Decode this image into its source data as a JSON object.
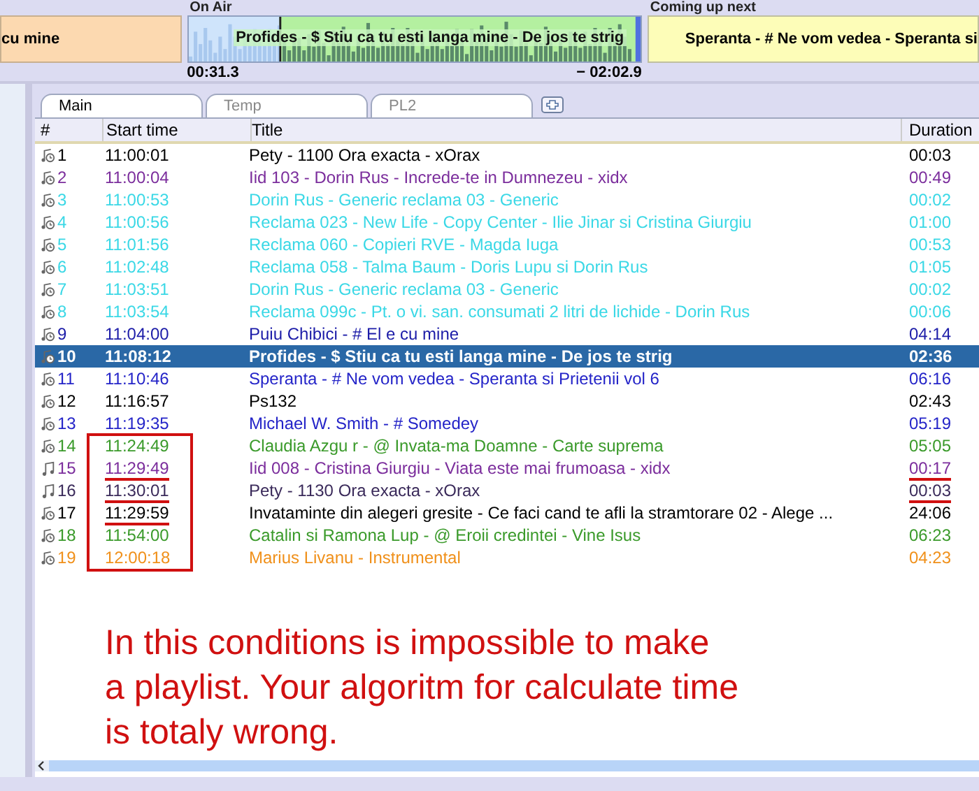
{
  "previous": {
    "title": "cu mine"
  },
  "on_air": {
    "label": "On Air",
    "title": "Profides - $ Stiu ca tu esti langa mine - De jos te strig",
    "elapsed": "00:31.3",
    "remaining": "− 02:02.9",
    "level": 0.2
  },
  "coming_up": {
    "label": "Coming up next",
    "title": "Speranta - # Ne vom vedea - Speranta si"
  },
  "tabs": [
    {
      "label": "Main",
      "selected": true
    },
    {
      "label": "Temp",
      "selected": false
    },
    {
      "label": "PL2",
      "selected": false
    }
  ],
  "columns": [
    "#",
    "Start time",
    "Title",
    "Duration"
  ],
  "rows": [
    {
      "kind": "timed",
      "num": "1",
      "start": "11:00:01",
      "title": "Pety - 1100 Ora exacta - xOrax",
      "duration": "00:03",
      "color": "#000000",
      "selected": false,
      "boxed": false,
      "start_marked": false,
      "duration_marked": false
    },
    {
      "kind": "timed",
      "num": "2",
      "start": "11:00:04",
      "title": "Iid 103 - Dorin Rus - Increde-te in Dumnezeu - xidx",
      "duration": "00:49",
      "color": "#7b2d9c",
      "selected": false,
      "boxed": false,
      "start_marked": false,
      "duration_marked": false
    },
    {
      "kind": "timed",
      "num": "3",
      "start": "11:00:53",
      "title": "Dorin Rus - Generic reclama 03 - Generic",
      "duration": "00:02",
      "color": "#3ad8e6",
      "selected": false,
      "boxed": false,
      "start_marked": false,
      "duration_marked": false
    },
    {
      "kind": "timed",
      "num": "4",
      "start": "11:00:56",
      "title": "Reclama 023 - New Life - Copy Center - Ilie Jinar si Cristina Giurgiu",
      "duration": "01:00",
      "color": "#3ad8e6",
      "selected": false,
      "boxed": false,
      "start_marked": false,
      "duration_marked": false
    },
    {
      "kind": "timed",
      "num": "5",
      "start": "11:01:56",
      "title": "Reclama 060 - Copieri RVE - Magda Iuga",
      "duration": "00:53",
      "color": "#3ad8e6",
      "selected": false,
      "boxed": false,
      "start_marked": false,
      "duration_marked": false
    },
    {
      "kind": "timed",
      "num": "6",
      "start": "11:02:48",
      "title": "Reclama 058 - Talma Baum - Doris Lupu si Dorin Rus",
      "duration": "01:05",
      "color": "#3ad8e6",
      "selected": false,
      "boxed": false,
      "start_marked": false,
      "duration_marked": false
    },
    {
      "kind": "timed",
      "num": "7",
      "start": "11:03:51",
      "title": "Dorin Rus - Generic reclama 03 - Generic",
      "duration": "00:02",
      "color": "#3ad8e6",
      "selected": false,
      "boxed": false,
      "start_marked": false,
      "duration_marked": false
    },
    {
      "kind": "timed",
      "num": "8",
      "start": "11:03:54",
      "title": "Reclama 099c - Pt. o vi. san. consumati 2 litri de lichide - Dorin Rus",
      "duration": "00:06",
      "color": "#3ad8e6",
      "selected": false,
      "boxed": false,
      "start_marked": false,
      "duration_marked": false
    },
    {
      "kind": "timed",
      "num": "9",
      "start": "11:04:00",
      "title": "Puiu Chibici - # El e cu mine",
      "duration": "04:14",
      "color": "#1c1ca8",
      "selected": false,
      "boxed": false,
      "start_marked": false,
      "duration_marked": false
    },
    {
      "kind": "timed",
      "num": "10",
      "start": "11:08:12",
      "title": "Profides - $ Stiu ca tu esti langa mine - De jos te strig",
      "duration": "02:36",
      "selected": true,
      "boxed": false,
      "start_marked": false,
      "duration_marked": false
    },
    {
      "kind": "timed",
      "num": "11",
      "start": "11:10:46",
      "title": "Speranta - # Ne vom vedea - Speranta si Prietenii vol 6",
      "duration": "06:16",
      "color": "#2424c8",
      "selected": false,
      "boxed": false,
      "start_marked": false,
      "duration_marked": false
    },
    {
      "kind": "timed",
      "num": "12",
      "start": "11:16:57",
      "title": "Ps132",
      "duration": "02:43",
      "color": "#000000",
      "selected": false,
      "boxed": false,
      "start_marked": false,
      "duration_marked": false
    },
    {
      "kind": "timed",
      "num": "13",
      "start": "11:19:35",
      "title": "Michael W. Smith - # Somedey",
      "duration": "05:19",
      "color": "#2424c8",
      "selected": false,
      "boxed": false,
      "start_marked": false,
      "duration_marked": false
    },
    {
      "kind": "timed",
      "num": "14",
      "start": "11:24:49",
      "title": "Claudia Azgu r - @ Invata-ma Doamne - Carte suprema",
      "duration": "05:05",
      "color": "#3a9a2a",
      "selected": false,
      "boxed": true,
      "start_marked": false,
      "duration_marked": false
    },
    {
      "kind": "note",
      "num": "15",
      "start": "11:29:49",
      "title": "Iid 008 - Cristina Giurgiu - Viata este mai frumoasa - xidx",
      "duration": "00:17",
      "color": "#7b2d9c",
      "selected": false,
      "boxed": true,
      "start_marked": true,
      "duration_marked": true
    },
    {
      "kind": "note",
      "num": "16",
      "start": "11:30:01",
      "title": "Pety - 1130 Ora exacta - xOrax",
      "duration": "00:03",
      "color": "#3a2a5a",
      "selected": false,
      "boxed": true,
      "start_marked": true,
      "duration_marked": true
    },
    {
      "kind": "timed",
      "num": "17",
      "start": "11:29:59",
      "title": "Invataminte din alegeri gresite - Ce faci cand te afli la stramtorare 02 - Alege ...",
      "duration": "24:06",
      "color": "#000000",
      "selected": false,
      "boxed": true,
      "start_marked": true,
      "duration_marked": false
    },
    {
      "kind": "timed",
      "num": "18",
      "start": "11:54:00",
      "title": "Catalin si Ramona Lup - @ Eroii credintei - Vine Isus",
      "duration": "06:23",
      "color": "#3a9a2a",
      "selected": false,
      "boxed": true,
      "start_marked": false,
      "duration_marked": false
    },
    {
      "kind": "timed",
      "num": "19",
      "start": "12:00:18",
      "title": "Marius Livanu - Instrumental",
      "duration": "04:23",
      "color": "#f0901a",
      "selected": false,
      "boxed": true,
      "start_marked": false,
      "duration_marked": false
    }
  ],
  "annotation": [
    "In this conditions is impossible to make",
    "a playlist. Your algoritm for calculate time",
    "is totaly wrong."
  ]
}
